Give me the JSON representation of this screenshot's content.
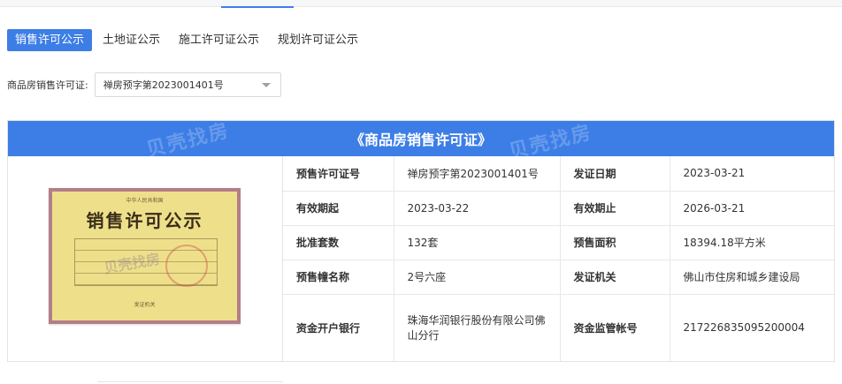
{
  "tabs": [
    {
      "label": "销售许可公示",
      "active": true
    },
    {
      "label": "土地证公示",
      "active": false
    },
    {
      "label": "施工许可证公示",
      "active": false
    },
    {
      "label": "规划许可证公示",
      "active": false
    }
  ],
  "selector": {
    "label": "商品房销售许可证:",
    "value": "禅房预字第2023001401号"
  },
  "card": {
    "title": "《商品房销售许可证》",
    "watermark": "贝壳找房",
    "certificate": {
      "top_text": "中华人民共和国",
      "title": "销售许可公示",
      "watermark": "贝壳找房",
      "bottom_text": "发证机关"
    },
    "rows": [
      {
        "k1": "预售许可证号",
        "v1": "禅房预字第2023001401号",
        "k2": "发证日期",
        "v2": "2023-03-21"
      },
      {
        "k1": "有效期起",
        "v1": "2023-03-22",
        "k2": "有效期止",
        "v2": "2026-03-21"
      },
      {
        "k1": "批准套数",
        "v1": "132套",
        "k2": "预售面积",
        "v2": "18394.18平方米"
      },
      {
        "k1": "预售幢名称",
        "v1": "2号六座",
        "k2": "发证机关",
        "v2": "佛山市住房和城乡建设局"
      },
      {
        "k1": "资金开户银行",
        "v1": "珠海华润银行股份有限公司佛山分行",
        "k2": "资金监管帐号",
        "v2": "217226835095200004"
      }
    ]
  },
  "colors": {
    "accent": "#3d7ee6",
    "certificate": "#eee08a",
    "certificate_border": "#b27f88"
  }
}
